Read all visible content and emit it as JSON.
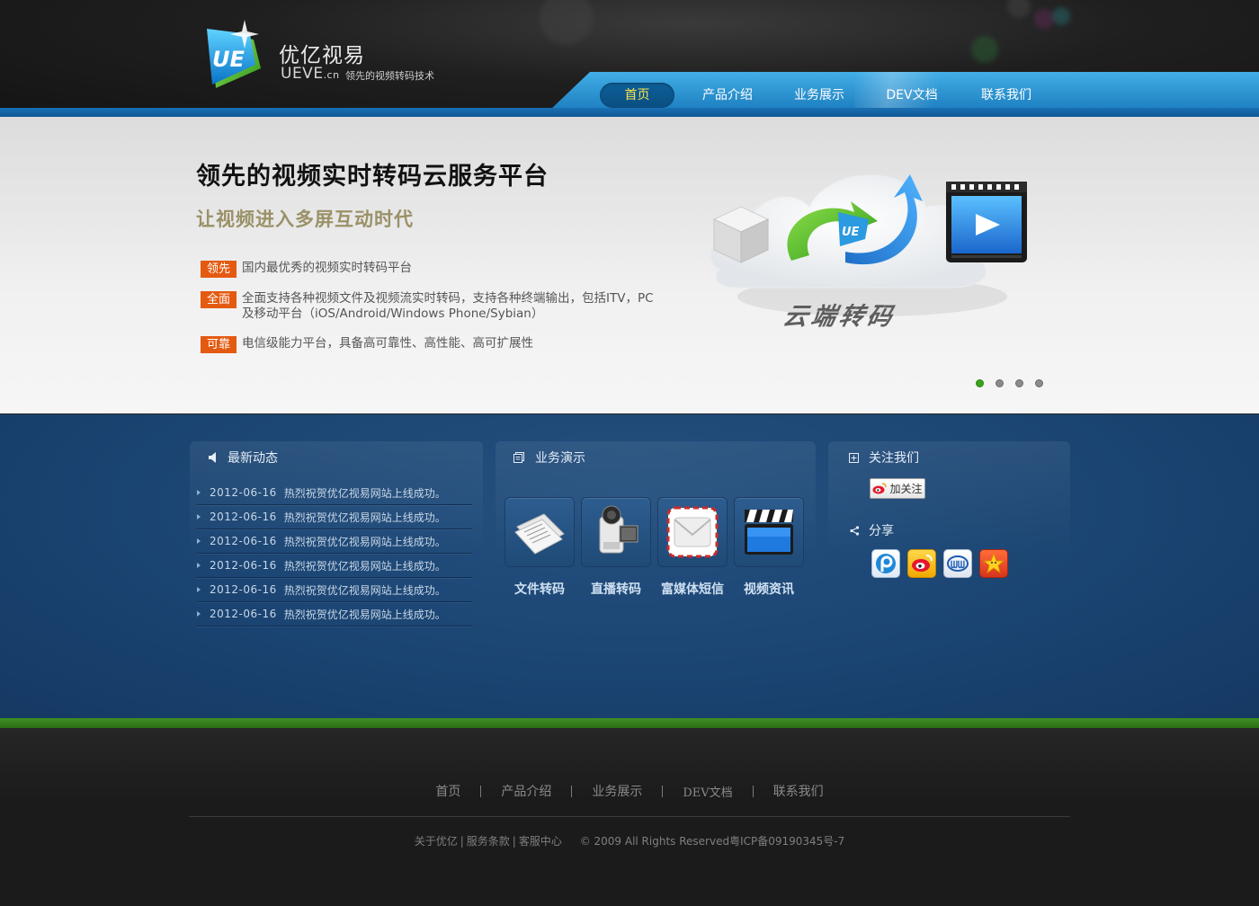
{
  "header": {
    "logo_title": "优亿视易",
    "logo_sub_main": "UEVE",
    "logo_sub_domain": ".cn",
    "logo_slogan": "领先的视频转码技术",
    "nav": [
      {
        "label": "首页",
        "active": true
      },
      {
        "label": "产品介绍",
        "active": false
      },
      {
        "label": "业务展示",
        "active": false
      },
      {
        "label": "DEV文档",
        "active": false
      },
      {
        "label": "联系我们",
        "active": false
      }
    ]
  },
  "banner": {
    "title": "领先的视频实时转码云服务平台",
    "subtitle": "让视频进入多屏互动时代",
    "features": [
      {
        "tag": "领先",
        "text": "国内最优秀的视频实时转码平台"
      },
      {
        "tag": "全面",
        "text": "全面支持各种视频文件及视频流实时转码，支持各种终端输出，包括ITV，PC及移动平台（iOS/Android/Windows Phone/Sybian）"
      },
      {
        "tag": "可靠",
        "text": "电信级能力平台，具备高可靠性、高性能、高可扩展性"
      }
    ],
    "graphic_label": "云端转码",
    "slides_total": 4,
    "slide_active": 1
  },
  "news": {
    "title": "最新动态",
    "items": [
      {
        "date": "2012-06-16",
        "text": "热烈祝贺优亿视易网站上线成功。"
      },
      {
        "date": "2012-06-16",
        "text": "热烈祝贺优亿视易网站上线成功。"
      },
      {
        "date": "2012-06-16",
        "text": "热烈祝贺优亿视易网站上线成功。"
      },
      {
        "date": "2012-06-16",
        "text": "热烈祝贺优亿视易网站上线成功。"
      },
      {
        "date": "2012-06-16",
        "text": "热烈祝贺优亿视易网站上线成功。"
      },
      {
        "date": "2012-06-16",
        "text": "热烈祝贺优亿视易网站上线成功。"
      }
    ]
  },
  "demos": {
    "title": "业务演示",
    "items": [
      {
        "label": "文件转码",
        "icon": "documents-icon"
      },
      {
        "label": "直播转码",
        "icon": "camcorder-icon"
      },
      {
        "label": "富媒体短信",
        "icon": "envelope-icon"
      },
      {
        "label": "视频资讯",
        "icon": "clapperboard-icon"
      }
    ]
  },
  "follow": {
    "title": "关注我们",
    "follow_button": "加关注",
    "share_title": "分享",
    "share_icons": [
      "pengyou-icon",
      "weibo-icon",
      "renren-icon",
      "qzone-icon"
    ]
  },
  "footer": {
    "nav": [
      "首页",
      "产品介绍",
      "业务展示",
      "DEV文档",
      "联系我们"
    ],
    "links": [
      "关于优亿",
      "服务条款",
      "客服中心"
    ],
    "copyright": "© 2009 All Rights Reserved粤ICP备09190345号-7"
  },
  "colors": {
    "nav_active_text": "#ffe24a",
    "tag_orange": "#e45a10",
    "main_blue": "#1a4371",
    "green_line": "#3f8f24",
    "dot_active": "#3aa21d"
  }
}
